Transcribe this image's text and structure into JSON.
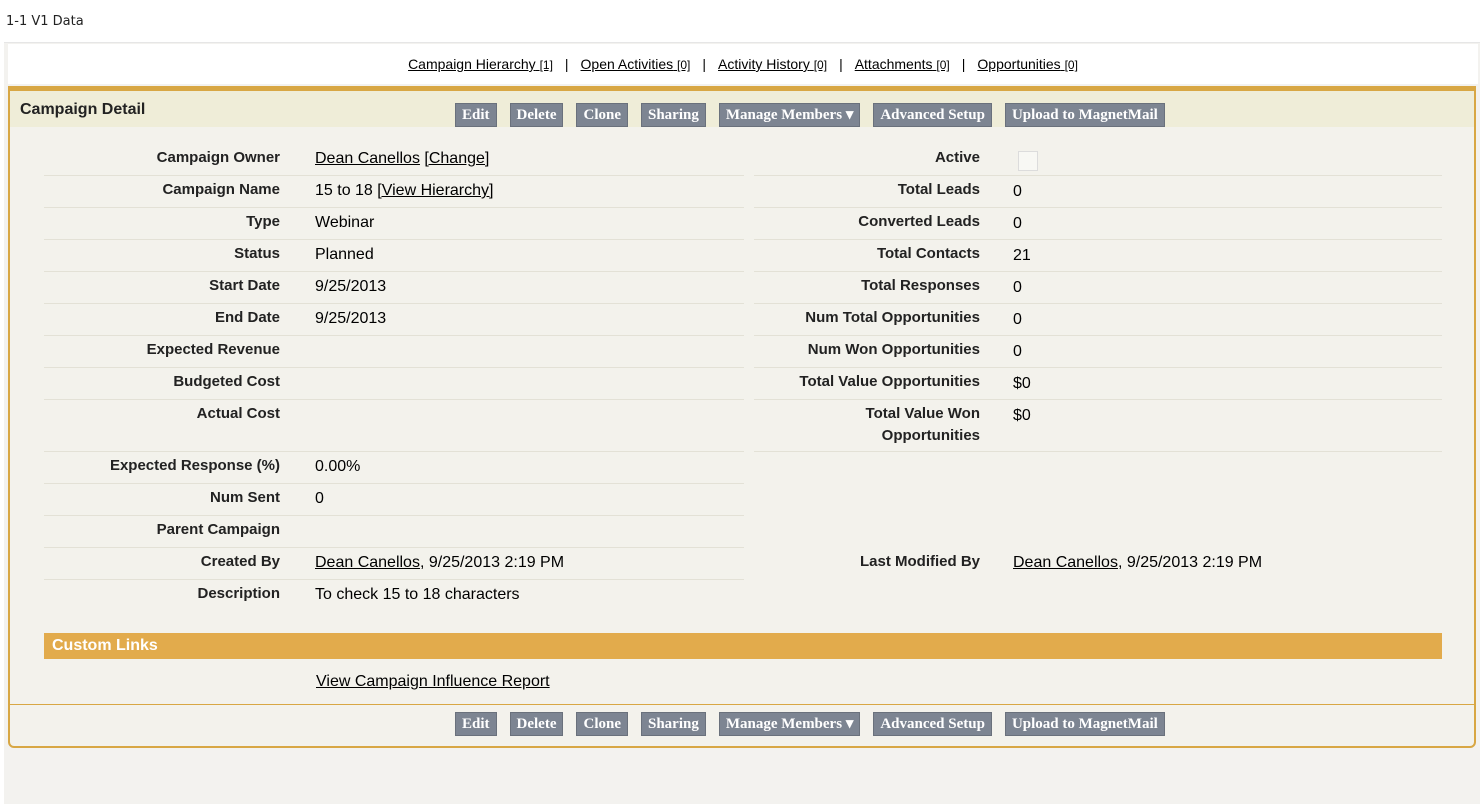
{
  "page_label": "1-1 V1 Data",
  "related_links": [
    {
      "label": "Campaign Hierarchy",
      "count": "[1]"
    },
    {
      "label": "Open Activities",
      "count": "[0]"
    },
    {
      "label": "Activity History",
      "count": "[0]"
    },
    {
      "label": "Attachments",
      "count": "[0]"
    },
    {
      "label": "Opportunities",
      "count": "[0]"
    }
  ],
  "separator": "|",
  "panel_title": "Campaign Detail",
  "buttons": {
    "edit": "Edit",
    "delete": "Delete",
    "clone": "Clone",
    "sharing": "Sharing",
    "manage_members": "Manage Members",
    "advanced_setup": "Advanced Setup",
    "upload": "Upload to MagnetMail"
  },
  "left_fields": {
    "campaign_owner": {
      "label": "Campaign Owner",
      "value": "Dean Canellos",
      "action": "[Change]"
    },
    "campaign_name": {
      "label": "Campaign Name",
      "value": "15 to 18",
      "action": "[View Hierarchy]"
    },
    "type": {
      "label": "Type",
      "value": "Webinar"
    },
    "status": {
      "label": "Status",
      "value": "Planned"
    },
    "start_date": {
      "label": "Start Date",
      "value": "9/25/2013"
    },
    "end_date": {
      "label": "End Date",
      "value": "9/25/2013"
    },
    "expected_revenue": {
      "label": "Expected Revenue",
      "value": ""
    },
    "budgeted_cost": {
      "label": "Budgeted Cost",
      "value": ""
    },
    "actual_cost": {
      "label": "Actual Cost",
      "value": ""
    },
    "expected_response": {
      "label": "Expected Response (%)",
      "value": "0.00%"
    },
    "num_sent": {
      "label": "Num Sent",
      "value": "0"
    },
    "parent_campaign": {
      "label": "Parent Campaign",
      "value": ""
    },
    "created_by": {
      "label": "Created By",
      "user": "Dean Canellos",
      "date": ", 9/25/2013 2:19 PM"
    },
    "description": {
      "label": "Description",
      "value": "To check 15 to 18 characters"
    }
  },
  "right_fields": {
    "active": {
      "label": "Active",
      "checked": false
    },
    "total_leads": {
      "label": "Total Leads",
      "value": "0"
    },
    "converted_leads": {
      "label": "Converted Leads",
      "value": "0"
    },
    "total_contacts": {
      "label": "Total Contacts",
      "value": "21"
    },
    "total_responses": {
      "label": "Total Responses",
      "value": "0"
    },
    "num_total_opps": {
      "label": "Num Total Opportunities",
      "value": "0"
    },
    "num_won_opps": {
      "label": "Num Won Opportunities",
      "value": "0"
    },
    "total_value_opps": {
      "label": "Total Value Opportunities",
      "value": "$0"
    },
    "total_value_won_line1": {
      "label": "Total Value Won",
      "value": "$0"
    },
    "total_value_won_line2": {
      "label": "Opportunities"
    },
    "last_modified_by": {
      "label": "Last Modified By",
      "user": "Dean Canellos",
      "date": ", 9/25/2013 2:19 PM"
    }
  },
  "custom_links": {
    "title": "Custom Links",
    "link": "View Campaign Influence Report"
  },
  "colors": {
    "accent": "#d8a744",
    "button": "#7d8592",
    "header_bg": "#efedd8"
  }
}
